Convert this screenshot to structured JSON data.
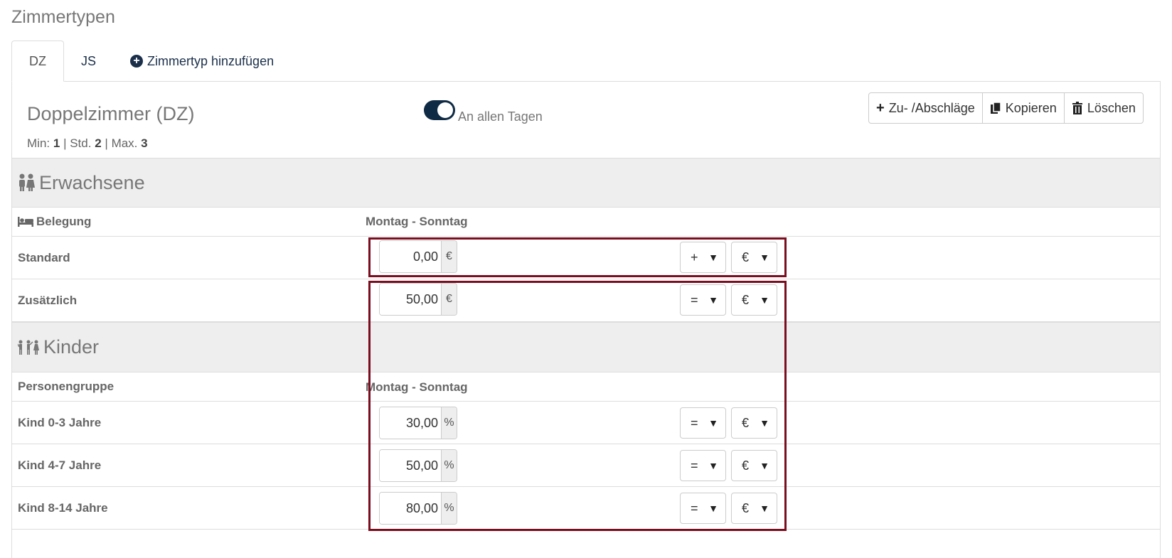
{
  "page_title": "Zimmertypen",
  "tabs": [
    {
      "label": "DZ"
    },
    {
      "label": "JS"
    },
    {
      "label": "Zimmertyp hinzufügen"
    }
  ],
  "room": {
    "title": "Doppelzimmer (DZ)",
    "min_label": "Min:",
    "min": "1",
    "std_label": "Std.",
    "std": "2",
    "max_label": "Max.",
    "max": "3",
    "sep": "|"
  },
  "toggle": {
    "label": "An allen Tagen",
    "on": true
  },
  "actions": {
    "surcharge": "Zu- /Abschläge",
    "copy": "Kopieren",
    "delete": "Löschen"
  },
  "adults": {
    "section_title": "Erwachsene",
    "col1": "Belegung",
    "col2": "Montag - Sonntag",
    "rows": [
      {
        "label": "Standard",
        "value": "0,00",
        "unit": "€",
        "operator": "+",
        "currency": "€"
      },
      {
        "label": "Zusätzlich",
        "value": "50,00",
        "unit": "€",
        "operator": "=",
        "currency": "€"
      }
    ]
  },
  "children": {
    "section_title": "Kinder",
    "col1": "Personengruppe",
    "col2": "Montag - Sonntag",
    "rows": [
      {
        "label": "Kind 0-3 Jahre",
        "value": "30,00",
        "unit": "%",
        "operator": "=",
        "currency": "€"
      },
      {
        "label": "Kind 4-7 Jahre",
        "value": "50,00",
        "unit": "%",
        "operator": "=",
        "currency": "€"
      },
      {
        "label": "Kind 8-14 Jahre",
        "value": "80,00",
        "unit": "%",
        "operator": "=",
        "currency": "€"
      }
    ]
  },
  "highlight_color": "#7a0d1e",
  "accent_color": "#0f2a44"
}
